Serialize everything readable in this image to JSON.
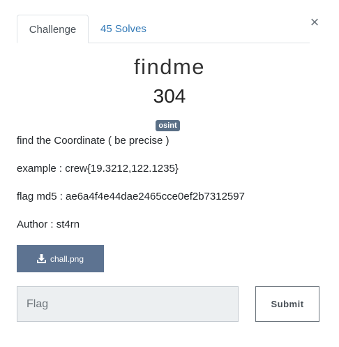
{
  "tabs": [
    {
      "label": "Challenge",
      "active": true
    },
    {
      "label": "45 Solves",
      "active": false
    }
  ],
  "close_symbol": "×",
  "challenge": {
    "title": "findme",
    "points": "304",
    "tag": "osint",
    "description": [
      "find the Coordinate ( be precise )",
      "example : crew{19.3212,122.1235}",
      "flag md5 : ae6a4f4e44dae2465cce0ef2b7312597",
      "Author : st4rn"
    ],
    "file": {
      "label": "chall.png",
      "icon": "download-icon"
    }
  },
  "flag_form": {
    "placeholder": "Flag",
    "value": "",
    "submit_label": "Submit"
  },
  "colors": {
    "tab_link": "#337ab7",
    "tag_bg": "#5a6f86",
    "file_button_bg": "#5d7391",
    "input_bg": "#eceff1"
  }
}
